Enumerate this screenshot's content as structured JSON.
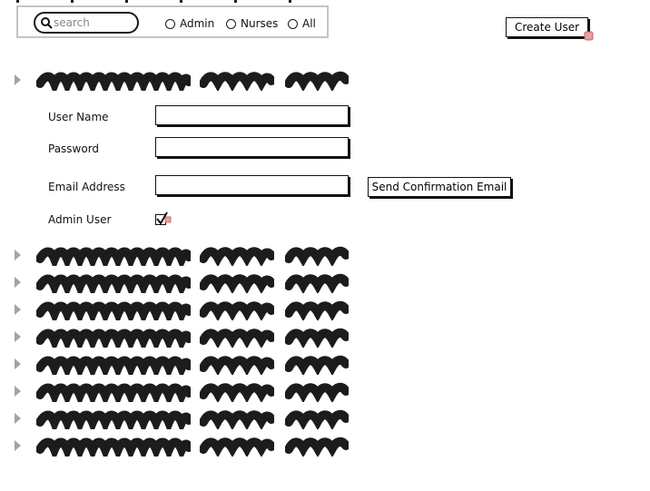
{
  "filter": {
    "search": {
      "placeholder": "search",
      "value": ""
    },
    "roles": [
      {
        "label": "Admin",
        "selected": false
      },
      {
        "label": "Nurses",
        "selected": false
      },
      {
        "label": "All",
        "selected": false
      }
    ]
  },
  "toolbar": {
    "create_label": "Create User"
  },
  "form": {
    "username_label": "User Name",
    "username_value": "",
    "password_label": "Password",
    "password_value": "",
    "email_label": "Email Address",
    "email_value": "",
    "send_label": "Send Confirmation Email",
    "admin_label": "Admin User",
    "admin_checked": true
  },
  "icons": {
    "search": "search-icon",
    "expand": "triangle-right-icon",
    "check": "check-icon",
    "cursor": "cursor-icon"
  },
  "colors": {
    "ink": "#1a1a1a",
    "arrow": "#a3a3a3",
    "box_border": "#c4c4c4",
    "cursor_accent": "#e07070"
  }
}
